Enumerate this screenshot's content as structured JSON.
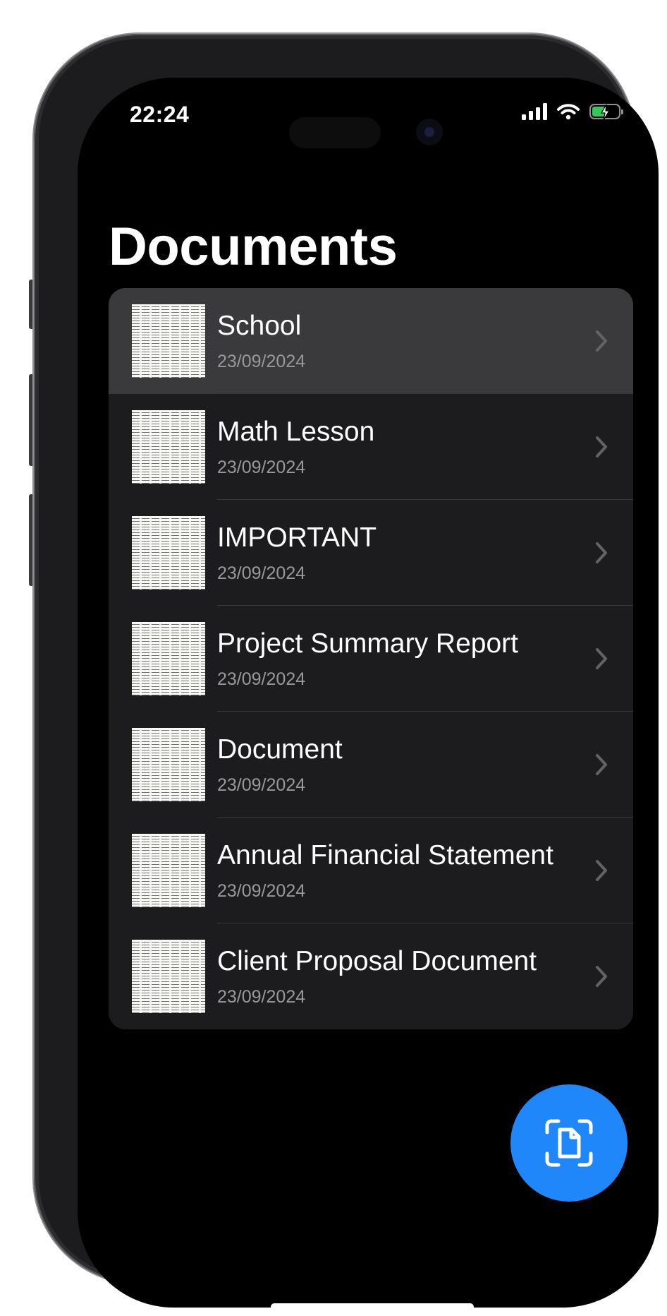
{
  "status_bar": {
    "time": "22:24",
    "icons": [
      "cellular-signal-icon",
      "wifi-icon",
      "battery-charging-icon"
    ]
  },
  "page": {
    "title": "Documents"
  },
  "documents": [
    {
      "name": "School",
      "date": "23/09/2024"
    },
    {
      "name": "Math Lesson",
      "date": "23/09/2024"
    },
    {
      "name": "IMPORTANT",
      "date": "23/09/2024"
    },
    {
      "name": "Project Summary Report",
      "date": "23/09/2024"
    },
    {
      "name": "Document",
      "date": "23/09/2024"
    },
    {
      "name": "Annual Financial Statement",
      "date": "23/09/2024"
    },
    {
      "name": "Client Proposal Document",
      "date": "23/09/2024"
    }
  ],
  "scan_button": {
    "icon": "document-scan-icon"
  },
  "colors": {
    "background": "#000000",
    "list_background": "#1c1c1e",
    "selected_row": "#3a3a3c",
    "accent": "#1f87fa",
    "secondary_text": "#98989d",
    "battery_charging": "#34c759"
  }
}
